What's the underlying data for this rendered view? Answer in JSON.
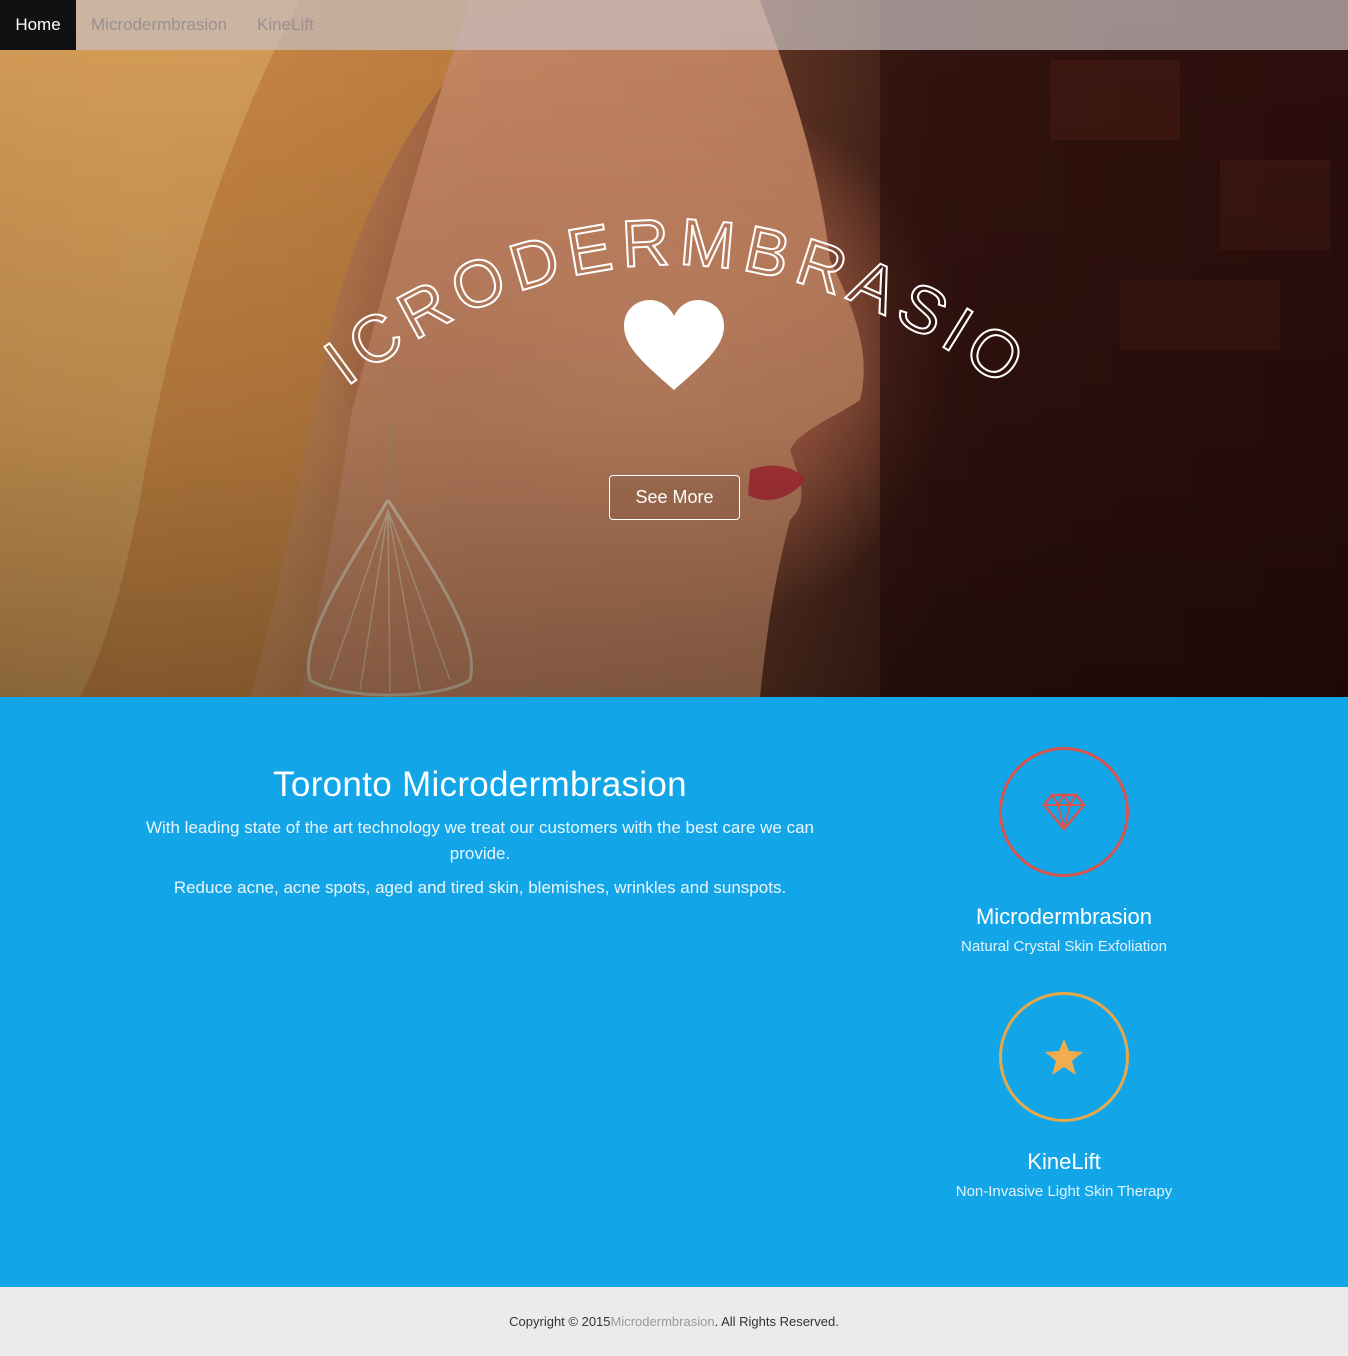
{
  "nav": {
    "items": [
      {
        "label": "Home",
        "active": true
      },
      {
        "label": "Microdermbrasion",
        "active": false
      },
      {
        "label": "KineLift",
        "active": false
      }
    ]
  },
  "hero": {
    "title": "Microdermbrasion",
    "button_label": "See More",
    "heart_icon": "heart-icon"
  },
  "intro": {
    "heading": "Toronto Microdermbrasion",
    "paragraph1": "With leading state of the art technology we treat our customers with the best care we can provide.",
    "paragraph2": "Reduce acne, acne spots, aged and tired skin, blemishes, wrinkles and sunspots."
  },
  "services": [
    {
      "icon": "diamond-icon",
      "title": "Microdermbrasion",
      "subtitle": "Natural Crystal Skin Exfoliation",
      "color": "#d9534f"
    },
    {
      "icon": "star-icon",
      "title": "KineLift",
      "subtitle": "Non-Invasive Light Skin Therapy",
      "color": "#f0ad4e"
    }
  ],
  "footer": {
    "prefix": "Copyright © 2015 ",
    "brand": "Microdermbrasion",
    "suffix": ". All Rights Reserved."
  },
  "colors": {
    "blue_section": "#12a6e8",
    "footer_bg": "#ebebeb",
    "nav_active_bg": "#111111"
  }
}
